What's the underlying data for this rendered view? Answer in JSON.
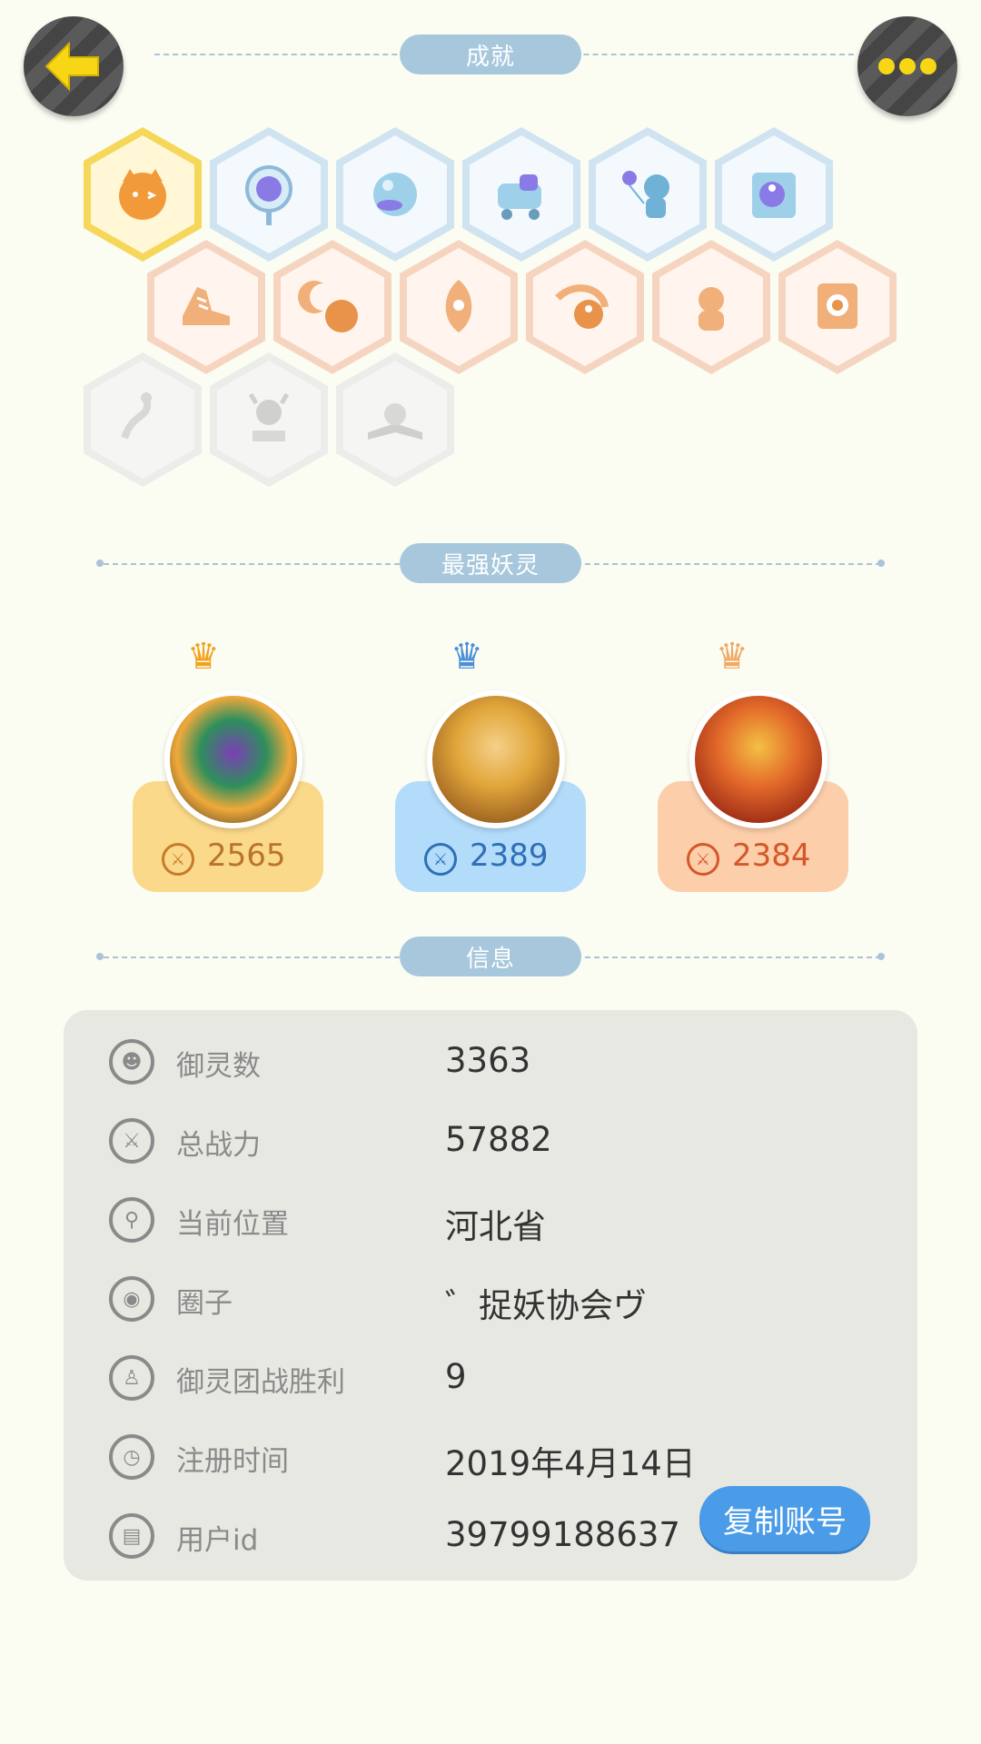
{
  "header": {
    "back_icon": "arrow-left-icon",
    "more_icon": "ellipsis-icon"
  },
  "sections": {
    "achievements": "成就",
    "strongest": "最强妖灵",
    "info": "信息"
  },
  "achievements": {
    "row1": [
      {
        "name": "badge-fox-gold",
        "color": "gold"
      },
      {
        "name": "badge-portal",
        "color": "blue"
      },
      {
        "name": "badge-orb",
        "color": "blue"
      },
      {
        "name": "badge-stroller-cat",
        "color": "blue"
      },
      {
        "name": "badge-cat-balloon",
        "color": "blue"
      },
      {
        "name": "badge-yinyang-book",
        "color": "blue"
      }
    ],
    "row2": [
      {
        "name": "badge-shoe",
        "color": "orange"
      },
      {
        "name": "badge-moon",
        "color": "orange"
      },
      {
        "name": "badge-egg",
        "color": "orange"
      },
      {
        "name": "badge-yinyang-swirl",
        "color": "orange"
      },
      {
        "name": "badge-creature",
        "color": "orange"
      },
      {
        "name": "badge-target-scroll",
        "color": "orange"
      }
    ],
    "row3": [
      {
        "name": "badge-dragon",
        "color": "gray"
      },
      {
        "name": "badge-devil-statue",
        "color": "gray"
      },
      {
        "name": "badge-book-cat",
        "color": "gray"
      }
    ]
  },
  "top_spirits": [
    {
      "score": "2565",
      "theme": "gold"
    },
    {
      "score": "2389",
      "theme": "blue"
    },
    {
      "score": "2384",
      "theme": "orange"
    }
  ],
  "info": {
    "rows": [
      {
        "icon": "spirit-icon",
        "label": "御灵数",
        "value": "3363"
      },
      {
        "icon": "sword-icon",
        "label": "总战力",
        "value": "57882"
      },
      {
        "icon": "location-pin-icon",
        "label": "当前位置",
        "value": "河北省"
      },
      {
        "icon": "circle-target-icon",
        "label": "圈子",
        "value": "゛捉妖协会ヴ"
      },
      {
        "icon": "trophy-figure-icon",
        "label": "御灵团战胜利",
        "value": "9"
      },
      {
        "icon": "clock-icon",
        "label": "注册时间",
        "value": "2019年4月14日"
      },
      {
        "icon": "id-card-icon",
        "label": "用户id",
        "value": "39799188637"
      }
    ],
    "copy_button": "复制账号"
  },
  "colors": {
    "accent": "#4a9be8",
    "section_pill": "#a7c7dc",
    "gold_card": "#fbd98a",
    "blue_card": "#b3dcfb",
    "orange_card": "#fcceaa"
  }
}
